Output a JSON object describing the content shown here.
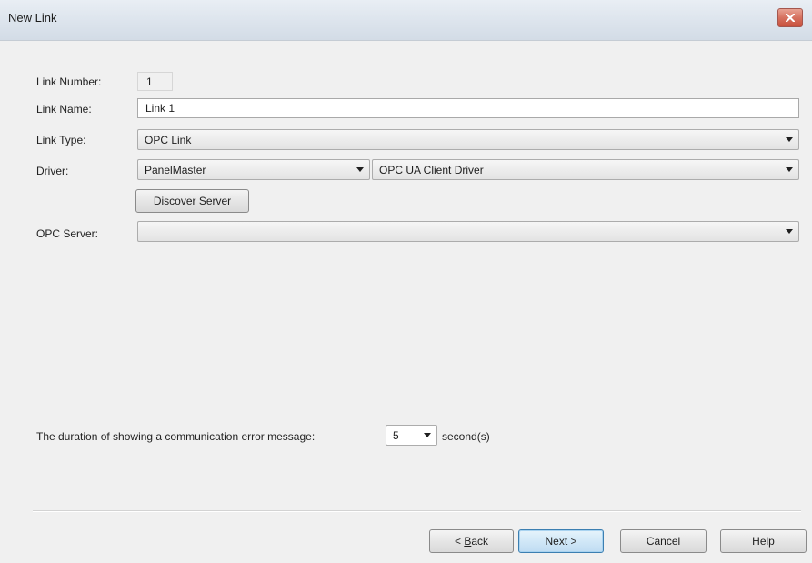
{
  "window": {
    "title": "New Link",
    "close_icon": "close-icon"
  },
  "form": {
    "link_number_label": "Link Number:",
    "link_number_value": "1",
    "link_name_label": "Link Name:",
    "link_name_value": "Link 1",
    "link_type_label": "Link Type:",
    "link_type_value": "OPC Link",
    "driver_label": "Driver:",
    "driver_vendor_value": "PanelMaster",
    "driver_model_value": "OPC UA Client Driver",
    "discover_button": "Discover Server",
    "opc_server_label": "OPC Server:",
    "opc_server_value": "",
    "error_duration_label": "The duration of showing a communication error message:",
    "error_duration_value": "5",
    "error_duration_unit": "second(s)"
  },
  "footer": {
    "back_prefix": "< ",
    "back_mnemonic": "B",
    "back_rest": "ack",
    "next_label": "Next >",
    "cancel_label": "Cancel",
    "help_label": "Help"
  },
  "colors": {
    "window_bg": "#f0f0f0",
    "close_button": "#c8503c",
    "default_button_border": "#3c7fb1"
  }
}
